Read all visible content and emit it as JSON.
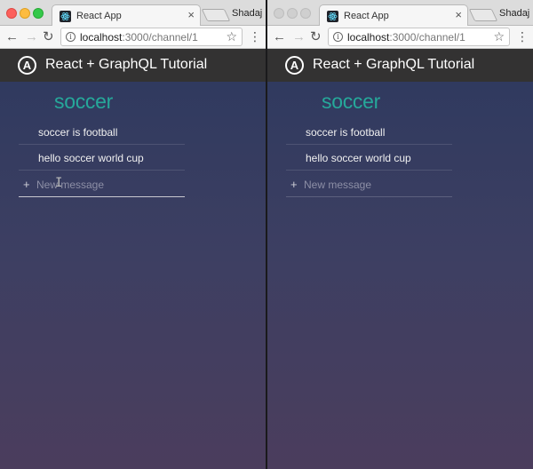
{
  "windows": [
    {
      "tab": {
        "title": "React App"
      },
      "profile": "Shadaj",
      "address": {
        "host": "localhost",
        "path": ":3000/channel/1"
      },
      "app": {
        "title": "React + GraphQL Tutorial",
        "logo_letter": "A"
      },
      "channel": {
        "name": "soccer",
        "messages": [
          {
            "text": "soccer is football"
          },
          {
            "text": "hello soccer world cup"
          }
        ],
        "new_message": {
          "placeholder": "New message",
          "value": ""
        }
      }
    },
    {
      "tab": {
        "title": "React App"
      },
      "profile": "Shadaj",
      "address": {
        "host": "localhost",
        "path": ":3000/channel/1"
      },
      "app": {
        "title": "React + GraphQL Tutorial",
        "logo_letter": "A"
      },
      "channel": {
        "name": "soccer",
        "messages": [
          {
            "text": "soccer is football"
          },
          {
            "text": "hello soccer world cup"
          }
        ],
        "new_message": {
          "placeholder": "New message",
          "value": ""
        }
      }
    }
  ],
  "icons": {
    "close": "×",
    "back": "←",
    "forward": "→",
    "reload": "↻",
    "info": "i",
    "star": "☆",
    "menu": "⋮",
    "plus": "+",
    "text_cursor": "I"
  },
  "colors": {
    "channel_name": "#26a89a",
    "appbar": "#333232",
    "content_top": "#303a5f",
    "content_bottom": "#4b3d5d"
  }
}
